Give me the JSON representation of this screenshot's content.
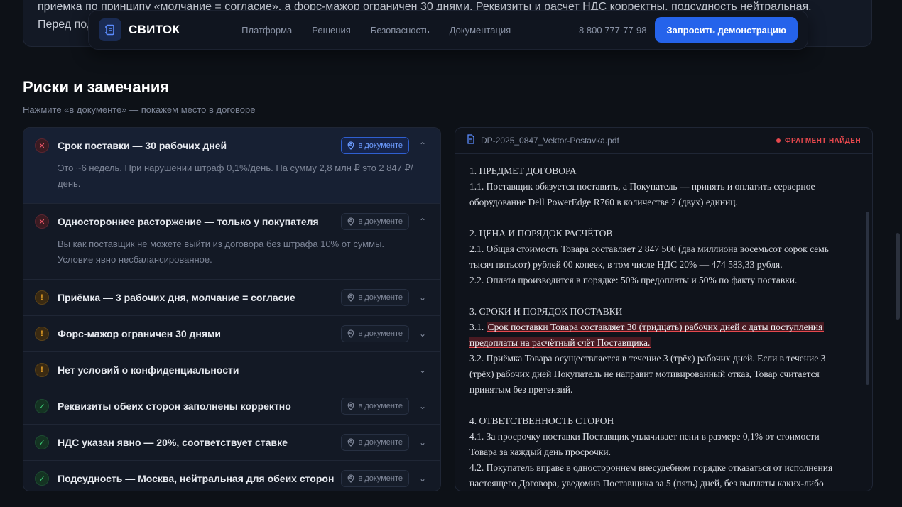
{
  "summary": {
    "line1": "приемка по принципу «молчание = согласие», а форс-мажор ограничен 30 днями. Реквизиты и расчет НДС корректны, подсудность нейтральная.",
    "line2": "Перед под"
  },
  "nav": {
    "brand": "СВИТОК",
    "links": [
      "Платформа",
      "Решения",
      "Безопасность",
      "Документация"
    ],
    "phone": "8 800 777-77-98",
    "cta": "Запросить демонстрацию"
  },
  "section": {
    "title": "Риски и замечания",
    "hint": "Нажмите «в документе» — покажем место в договоре"
  },
  "risks": [
    {
      "status": "bad",
      "title": "Срок поставки — 30 рабочих дней",
      "doc_label": "в документе",
      "active": true,
      "expanded": true,
      "detail": [
        "Это ~6 недель. При нарушении штраф 0,1%/день. На сумму 2,8 млн ₽ это 2 847 ₽/",
        "день."
      ]
    },
    {
      "status": "bad",
      "title": "Одностороннее расторжение — только у покупателя",
      "doc_label": "в документе",
      "expanded": true,
      "detail": [
        "Вы как поставщик не можете выйти из договора без штрафа 10% от суммы.",
        "Условие явно несбалансированное."
      ]
    },
    {
      "status": "warn",
      "title": "Приёмка — 3 рабочих дня, молчание = согласие",
      "doc_label": "в документе"
    },
    {
      "status": "warn",
      "title": "Форс-мажор ограничен 30 днями",
      "doc_label": "в документе"
    },
    {
      "status": "warn",
      "title": "Нет условий о конфиденциальности",
      "doc_label": ""
    },
    {
      "status": "ok",
      "title": "Реквизиты обеих сторон заполнены корректно",
      "doc_label": "в документе"
    },
    {
      "status": "ok",
      "title": "НДС указан явно — 20%, соответствует ставке",
      "doc_label": "в документе"
    },
    {
      "status": "ok",
      "title": "Подсудность — Москва, нейтральная для обеих сторон",
      "doc_label": "в документе"
    }
  ],
  "document": {
    "filename": "DP-2025_0847_Vektor-Postavka.pdf",
    "badge": "ФРАГМЕНТ НАЙДЕН",
    "p1_h": "1. ПРЕДМЕТ ДОГОВОРА",
    "p1_1": "1.1. Поставщик обязуется поставить, а Покупатель — принять и оплатить серверное",
    "p1_2": "оборудование Dell PowerEdge R760 в количестве 2 (двух) единиц.",
    "p2_h": "2. ЦЕНА И ПОРЯДОК РАСЧЁТОВ",
    "p2_1": "2.1. Общая стоимость Товара составляет 2 847 500 (два миллиона восемьсот сорок семь",
    "p2_2": "тысяч пятьсот) рублей 00 копеек, в том числе НДС 20% — 474 583,33 рубля.",
    "p2_3": "2.2. Оплата производится в порядке: 50% предоплаты и 50% по факту поставки.",
    "p3_h": "3. СРОКИ И ПОРЯДОК ПОСТАВКИ",
    "p3_1_num": "3.1.",
    "p3_1_hl1": "Срок поставки Товара составляет 30 (тридцать) рабочих дней с даты поступления",
    "p3_1_hl2": "предоплаты на расчётный счёт Поставщика.",
    "p3_2_1": "3.2. Приёмка Товара осуществляется в течение 3 (трёх) рабочих дней. Если в течение 3",
    "p3_2_2": "(трёх) рабочих дней Покупатель не направит мотивированный отказ, Товар считается",
    "p3_2_3": "принятым без претензий.",
    "p4_h": "4. ОТВЕТСТВЕННОСТЬ СТОРОН",
    "p4_1_1": "4.1. За просрочку поставки Поставщик уплачивает пени в размере 0,1% от стоимости",
    "p4_1_2": "Товара за каждый день просрочки.",
    "p4_2_1": "4.2. Покупатель вправе в одностороннем внесудебном порядке отказаться от исполнения",
    "p4_2_2": "настоящего Договора, уведомив Поставщика за 5 (пять) дней, без выплаты каких-либо"
  },
  "colors": {
    "accent": "#2563eb",
    "danger": "#e5484d",
    "warning": "#f0a728",
    "success": "#3ecf79"
  }
}
